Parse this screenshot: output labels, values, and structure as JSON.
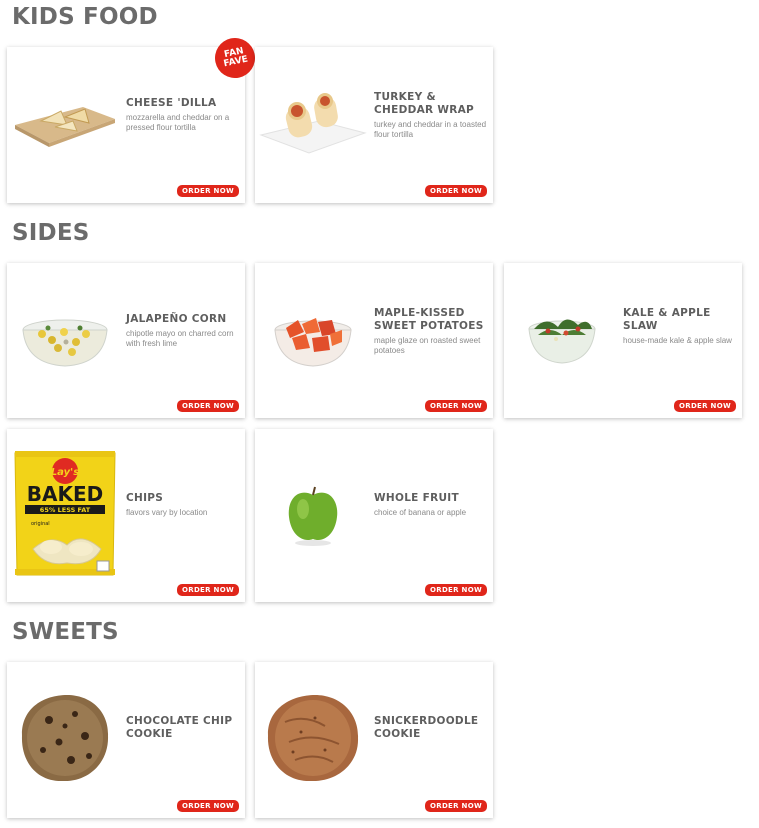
{
  "sections": [
    {
      "title": "KIDS FOOD",
      "items": [
        {
          "name": "CHEESE 'DILLA",
          "desc": "mozzarella and cheddar on a pressed flour tortilla",
          "button": "ORDER NOW",
          "badge": [
            "FAN",
            "FAVE"
          ]
        },
        {
          "name": "TURKEY & CHEDDAR WRAP",
          "desc": "turkey and cheddar in a toasted flour tortilla",
          "button": "ORDER NOW"
        }
      ]
    },
    {
      "title": "SIDES",
      "items": [
        {
          "name": "JALAPEÑO CORN",
          "desc": "chipotle mayo on charred corn with fresh lime",
          "button": "ORDER NOW"
        },
        {
          "name": "MAPLE-KISSED SWEET POTATOES",
          "desc": "maple glaze on roasted sweet potatoes",
          "button": "ORDER NOW"
        },
        {
          "name": "KALE & APPLE SLAW",
          "desc": "house-made kale & apple slaw",
          "button": "ORDER NOW"
        },
        {
          "name": "CHIPS",
          "desc": "flavors vary by location",
          "button": "ORDER NOW",
          "package": {
            "brand": "Lay's",
            "title": "BAKED",
            "tagline": "65% LESS FAT",
            "flavor": "original"
          }
        },
        {
          "name": "WHOLE FRUIT",
          "desc": "choice of banana or apple",
          "button": "ORDER NOW"
        }
      ]
    },
    {
      "title": "SWEETS",
      "items": [
        {
          "name": "CHOCOLATE CHIP COOKIE",
          "desc": "",
          "button": "ORDER NOW"
        },
        {
          "name": "SNICKERDOODLE COOKIE",
          "desc": "",
          "button": "ORDER NOW"
        }
      ]
    }
  ],
  "colors": {
    "accent": "#e0261a",
    "heading": "#6b6b6b",
    "card_bg": "#ffffff"
  }
}
